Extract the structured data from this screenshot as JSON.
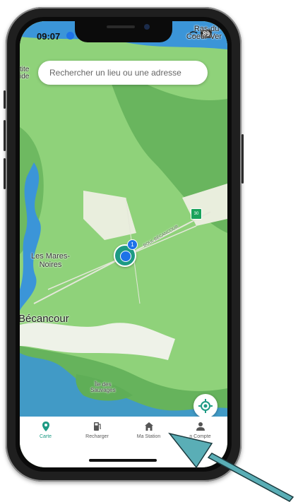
{
  "status_bar": {
    "time": "09:07",
    "battery": "89"
  },
  "search": {
    "placeholder": "Rechercher un lieu ou une adresse"
  },
  "map": {
    "labels": {
      "ras_du_coeur_1": "Ras-du-",
      "ras_du_coeur_2": "Coeur-Ver",
      "tite_1": "tite",
      "tite_2": "ide",
      "mares_1": "Les Mares-",
      "mares_2": "Noires",
      "becancour": "Bécancour",
      "ile_1": "Île des",
      "ile_2": "Sauvages",
      "road": "BOUL BÉCANCOUR",
      "road_sign": "30"
    },
    "marker_badge": "1"
  },
  "tabs": [
    {
      "label": "Carte",
      "icon": "map-pin-icon",
      "active": true
    },
    {
      "label": "Recharger",
      "icon": "charger-icon",
      "active": false
    },
    {
      "label": "Ma Station",
      "icon": "home-icon",
      "active": false
    },
    {
      "label": "n Compte",
      "icon": "user-icon",
      "active": false
    }
  ],
  "colors": {
    "accent": "#1d9a84",
    "marker_blue": "#1e73e8",
    "map_green": "#8fd27a",
    "map_dark_green": "#5fae57",
    "water": "#3b95d8",
    "arrow": "#5aaeb6"
  }
}
